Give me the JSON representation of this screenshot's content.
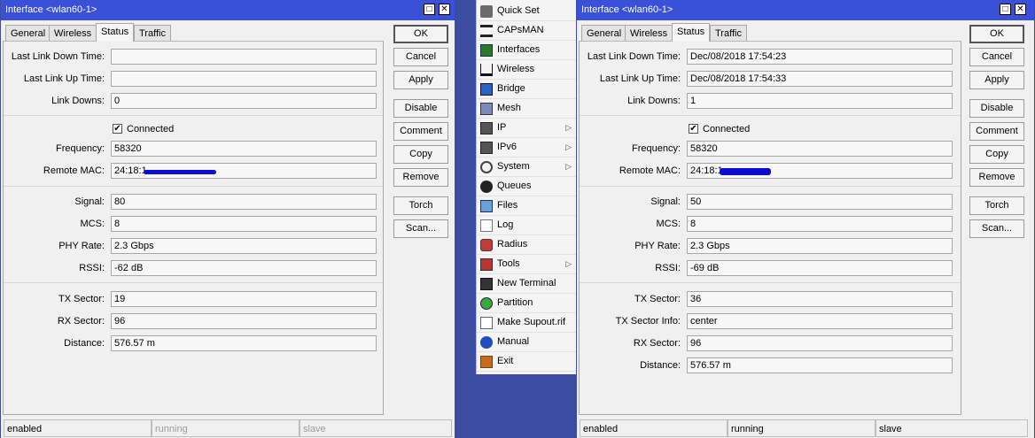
{
  "left": {
    "title": "Interface <wlan60-1>",
    "tabs": [
      "General",
      "Wireless",
      "Status",
      "Traffic"
    ],
    "fields": {
      "last_link_down_time": {
        "label": "Last Link Down Time:",
        "value": ""
      },
      "last_link_up_time": {
        "label": "Last Link Up Time:",
        "value": ""
      },
      "link_downs": {
        "label": "Link Downs:",
        "value": "0"
      },
      "connected": {
        "label": "Connected"
      },
      "frequency": {
        "label": "Frequency:",
        "value": "58320"
      },
      "remote_mac": {
        "label": "Remote MAC:",
        "value": "24:18:1"
      },
      "signal": {
        "label": "Signal:",
        "value": "80"
      },
      "mcs": {
        "label": "MCS:",
        "value": "8"
      },
      "phy_rate": {
        "label": "PHY Rate:",
        "value": "2.3 Gbps"
      },
      "rssi": {
        "label": "RSSI:",
        "value": "-62 dB"
      },
      "tx_sector": {
        "label": "TX Sector:",
        "value": "19"
      },
      "rx_sector": {
        "label": "RX Sector:",
        "value": "96"
      },
      "distance": {
        "label": "Distance:",
        "value": "576.57 m"
      }
    },
    "status": [
      "enabled",
      "running",
      "slave"
    ]
  },
  "right": {
    "title": "Interface <wlan60-1>",
    "tabs": [
      "General",
      "Wireless",
      "Status",
      "Traffic"
    ],
    "fields": {
      "last_link_down_time": {
        "label": "Last Link Down Time:",
        "value": "Dec/08/2018 17:54:23"
      },
      "last_link_up_time": {
        "label": "Last Link Up Time:",
        "value": "Dec/08/2018 17:54:33"
      },
      "link_downs": {
        "label": "Link Downs:",
        "value": "1"
      },
      "connected": {
        "label": "Connected"
      },
      "frequency": {
        "label": "Frequency:",
        "value": "58320"
      },
      "remote_mac": {
        "label": "Remote MAC:",
        "value": "24:18:1"
      },
      "signal": {
        "label": "Signal:",
        "value": "50"
      },
      "mcs": {
        "label": "MCS:",
        "value": "8"
      },
      "phy_rate": {
        "label": "PHY Rate:",
        "value": "2.3 Gbps"
      },
      "rssi": {
        "label": "RSSI:",
        "value": "-69 dB"
      },
      "tx_sector": {
        "label": "TX Sector:",
        "value": "36"
      },
      "tx_sector_info": {
        "label": "TX Sector Info:",
        "value": "center"
      },
      "rx_sector": {
        "label": "RX Sector:",
        "value": "96"
      },
      "distance": {
        "label": "Distance:",
        "value": "576.57 m"
      }
    },
    "status": [
      "enabled",
      "running",
      "slave"
    ]
  },
  "buttons": {
    "ok": "OK",
    "cancel": "Cancel",
    "apply": "Apply",
    "disable": "Disable",
    "comment": "Comment",
    "copy": "Copy",
    "remove": "Remove",
    "torch": "Torch",
    "scan": "Scan..."
  },
  "menu": [
    {
      "label": "Quick Set",
      "icon": "quick-set-icon"
    },
    {
      "label": "CAPsMAN",
      "icon": "capsman-icon"
    },
    {
      "label": "Interfaces",
      "icon": "interfaces-icon"
    },
    {
      "label": "Wireless",
      "icon": "wireless-icon"
    },
    {
      "label": "Bridge",
      "icon": "bridge-icon"
    },
    {
      "label": "Mesh",
      "icon": "mesh-icon"
    },
    {
      "label": "IP",
      "icon": "ip-icon",
      "submenu": true
    },
    {
      "label": "IPv6",
      "icon": "ipv6-icon",
      "submenu": true
    },
    {
      "label": "System",
      "icon": "system-icon",
      "submenu": true
    },
    {
      "label": "Queues",
      "icon": "queues-icon"
    },
    {
      "label": "Files",
      "icon": "files-icon"
    },
    {
      "label": "Log",
      "icon": "log-icon"
    },
    {
      "label": "Radius",
      "icon": "radius-icon"
    },
    {
      "label": "Tools",
      "icon": "tools-icon",
      "submenu": true
    },
    {
      "label": "New Terminal",
      "icon": "terminal-icon"
    },
    {
      "label": "Partition",
      "icon": "partition-icon"
    },
    {
      "label": "Make Supout.rif",
      "icon": "supout-icon"
    },
    {
      "label": "Manual",
      "icon": "manual-icon"
    },
    {
      "label": "Exit",
      "icon": "exit-icon"
    }
  ],
  "colors": {
    "titlebar": "#3a50d6",
    "menu_background": "#3c4ca0",
    "redaction": "#0b0bd4"
  }
}
